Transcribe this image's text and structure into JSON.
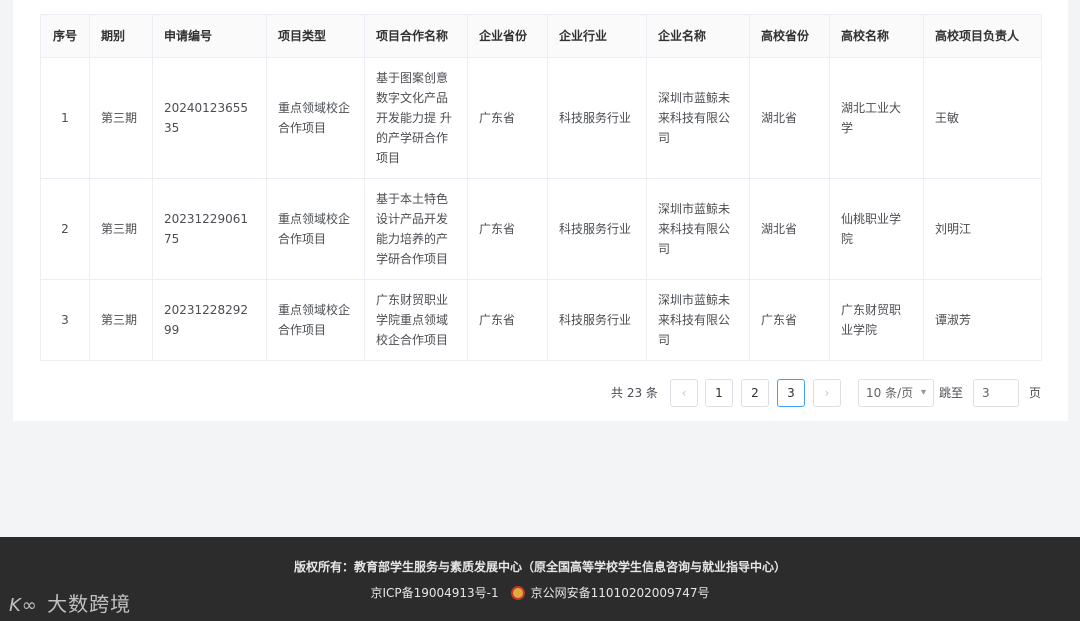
{
  "table": {
    "headers": [
      "序号",
      "期别",
      "申请编号",
      "项目类型",
      "项目合作名称",
      "企业省份",
      "企业行业",
      "企业名称",
      "高校省份",
      "高校名称",
      "高校项目负责人"
    ],
    "rows": [
      [
        "1",
        "第三期",
        "2024012365535",
        "重点领域校企合作项目",
        "基于图案创意数字文化产品开发能力提 升的产学研合作项目",
        "广东省",
        "科技服务行业",
        "深圳市蓝鲸未来科技有限公司",
        "湖北省",
        "湖北工业大学",
        "王敏"
      ],
      [
        "2",
        "第三期",
        "2023122906175",
        "重点领域校企合作项目",
        "基于本土特色设计产品开发能力培养的产学研合作项目",
        "广东省",
        "科技服务行业",
        "深圳市蓝鲸未来科技有限公司",
        "湖北省",
        "仙桃职业学院",
        "刘明江"
      ],
      [
        "3",
        "第三期",
        "2023122829299",
        "重点领域校企合作项目",
        "广东财贸职业学院重点领域校企合作项目",
        "广东省",
        "科技服务行业",
        "深圳市蓝鲸未来科技有限公司",
        "广东省",
        "广东财贸职业学院",
        "谭淑芳"
      ]
    ]
  },
  "pagination": {
    "total_text": "共 23 条",
    "prev": "‹",
    "next": "›",
    "pages": [
      "1",
      "2",
      "3"
    ],
    "current": 3,
    "page_size": "10 条/页",
    "page_size_icon": "chevron-down-icon",
    "jump_label": "跳至",
    "jump_value": "3",
    "page_unit": "页"
  },
  "footer": {
    "line1": "版权所有：教育部学生服务与素质发展中心（原全国高等学校学生信息咨询与就业指导中心）",
    "icp": "京ICP备19004913号-1",
    "police_icon": "police-badge-icon",
    "police": "京公网安备11010202009747号"
  },
  "watermark": {
    "logo": "K∞",
    "text": "大数跨境"
  },
  "colors": {
    "accent": "#409eff",
    "footer_bg": "#2c2c2c",
    "page_bg": "#f3f4f6"
  }
}
